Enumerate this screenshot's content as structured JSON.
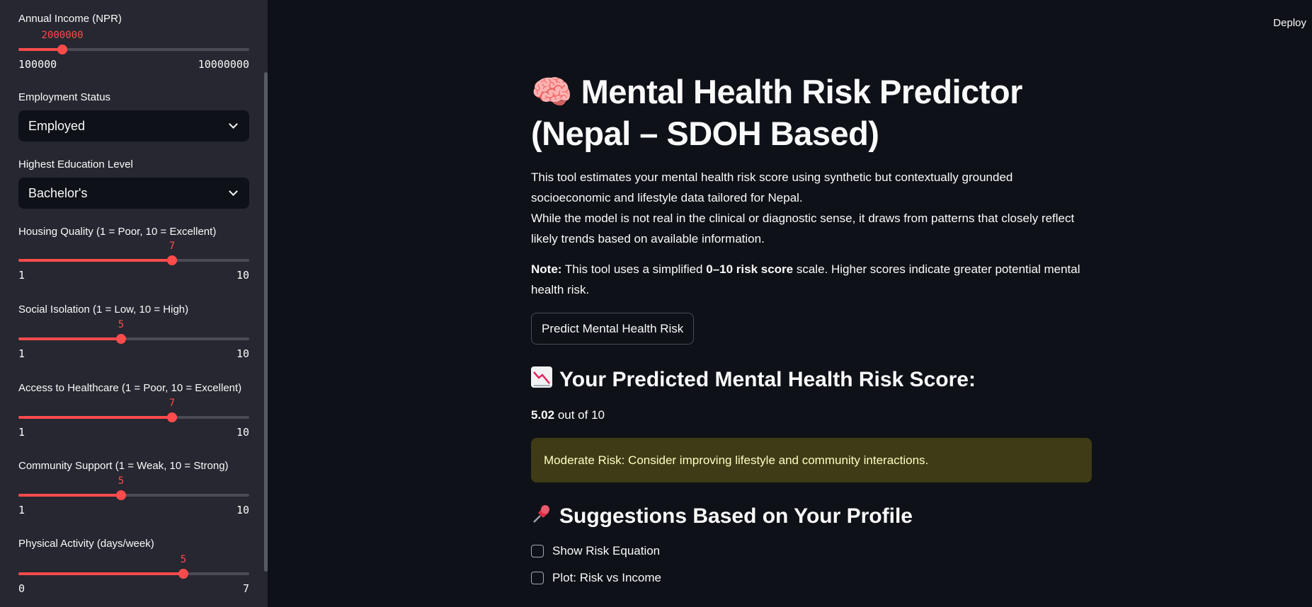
{
  "sidebar": {
    "income": {
      "label": "Annual Income (NPR)",
      "value": "2000000",
      "min": "100000",
      "max": "10000000",
      "fraction": 0.19
    },
    "employment": {
      "label": "Employment Status",
      "selected": "Employed"
    },
    "education": {
      "label": "Highest Education Level",
      "selected": "Bachelor's"
    },
    "housing": {
      "label": "Housing Quality (1 = Poor, 10 = Excellent)",
      "value": "7",
      "min": "1",
      "max": "10",
      "fraction": 0.667
    },
    "isolation": {
      "label": "Social Isolation (1 = Low, 10 = High)",
      "value": "5",
      "min": "1",
      "max": "10",
      "fraction": 0.444
    },
    "healthcare": {
      "label": "Access to Healthcare (1 = Poor, 10 = Excellent)",
      "value": "7",
      "min": "1",
      "max": "10",
      "fraction": 0.667
    },
    "community": {
      "label": "Community Support (1 = Weak, 10 = Strong)",
      "value": "5",
      "min": "1",
      "max": "10",
      "fraction": 0.444
    },
    "activity": {
      "label": "Physical Activity (days/week)",
      "value": "5",
      "min": "0",
      "max": "7",
      "fraction": 0.714
    }
  },
  "header": {
    "deploy_label": "Deploy"
  },
  "main": {
    "title_emoji": "🧠",
    "title": "Mental Health Risk Predictor (Nepal – SDOH Based)",
    "description_1": "This tool estimates your mental health risk score using synthetic but contextually grounded socioeconomic and lifestyle data tailored for Nepal.",
    "description_2": "While the model is not real in the clinical or diagnostic sense, it draws from patterns that closely reflect likely trends based on available information.",
    "note_prefix": "Note:",
    "note_mid": " This tool uses a simplified ",
    "note_scale": "0–10 risk score",
    "note_suffix": " scale. Higher scores indicate greater potential mental health risk.",
    "predict_button": "Predict Mental Health Risk",
    "score_heading": "Your Predicted Mental Health Risk Score:",
    "score_value": "5.02",
    "score_suffix": " out of 10",
    "alert_text": "Moderate Risk: Consider improving lifestyle and community interactions.",
    "suggestions_heading": "Suggestions Based on Your Profile",
    "checkbox_1": "Show Risk Equation",
    "checkbox_2": "Plot: Risk vs Income"
  },
  "colors": {
    "accent": "#ff4b4b",
    "background": "#0e1117",
    "sidebar": "#262730",
    "warning_bg": "#3e3b16",
    "warning_text": "#ffffc2"
  }
}
